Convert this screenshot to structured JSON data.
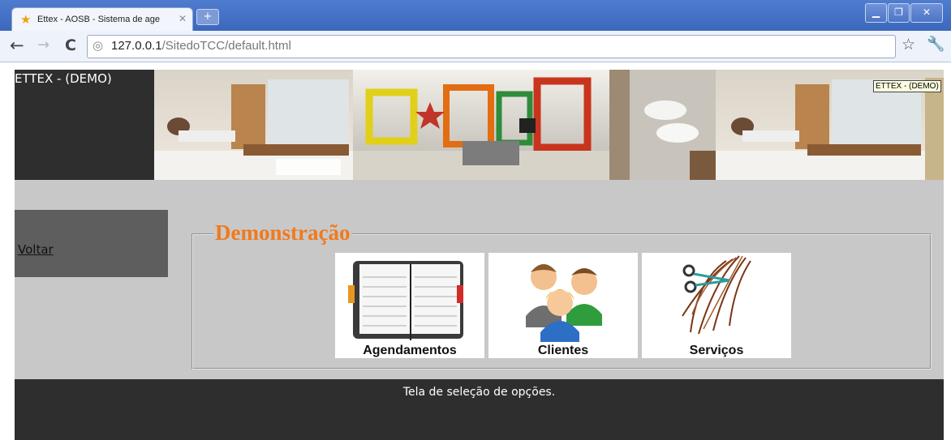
{
  "browser": {
    "tab_title": "Ettex - AOSB - Sistema de age",
    "url_host": "127.0.0.1",
    "url_path": "/SitedoTCC/default.html"
  },
  "page": {
    "brand": "ETTEX - (DEMO)",
    "tooltip": "ETTEX - (DEMO)",
    "back_link": "Voltar",
    "section_title": "Demonstração",
    "options": [
      {
        "label": "Agendamentos",
        "icon": "agenda-book-icon"
      },
      {
        "label": "Clientes",
        "icon": "clients-group-icon"
      },
      {
        "label": "Serviços",
        "icon": "scissors-hair-icon"
      }
    ],
    "footer_text": "Tela de seleção de opções."
  },
  "colors": {
    "header_bg": "#2e2e2e",
    "content_bg": "#c8c8c8",
    "sidebar_bg": "#5e5e5e",
    "section_title": "#f07a1e"
  }
}
